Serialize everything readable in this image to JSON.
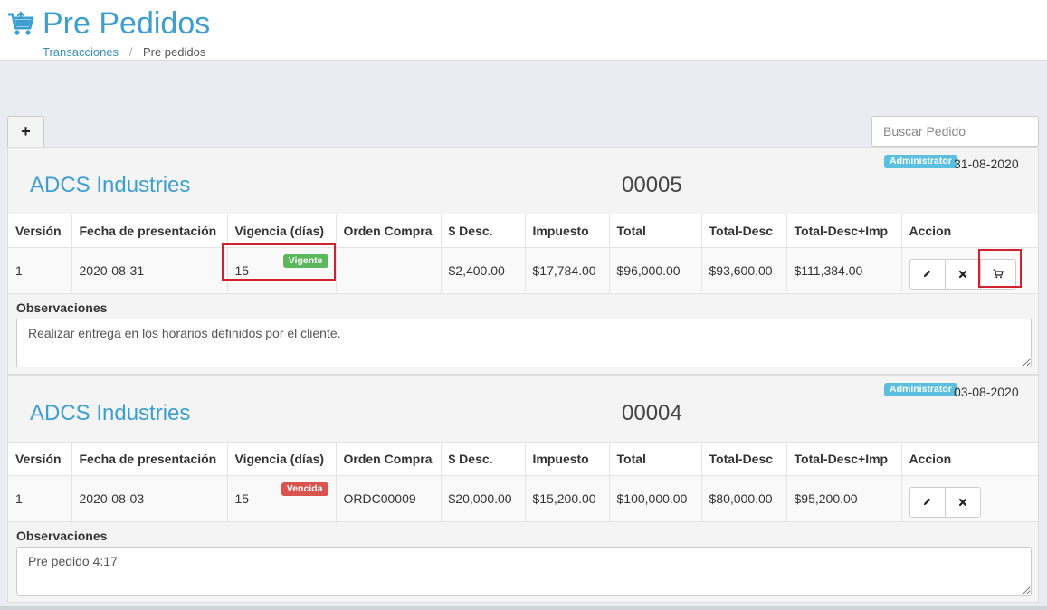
{
  "header": {
    "title": "Pre Pedidos",
    "icon": "shopping-cart-icon",
    "accent_color": "#3d9fd1",
    "breadcrumb": [
      {
        "label": "Transacciones"
      },
      {
        "label": "Pre pedidos"
      }
    ]
  },
  "toolbar": {
    "add_label": "+",
    "search_placeholder": "Buscar Pedido"
  },
  "table_columns": [
    "Versión",
    "Fecha de presentación",
    "Vigencia (días)",
    "Orden Compra",
    "$ Desc.",
    "Impuesto",
    "Total",
    "Total-Desc",
    "Total-Desc+Imp",
    "Accion"
  ],
  "observations_label": "Observaciones",
  "orders": [
    {
      "user_badge": "Administrator",
      "date": "31-08-2020",
      "client": "ADCS Industries",
      "number": "00005",
      "row": {
        "version": "1",
        "fecha": "2020-08-31",
        "vigencia": "15",
        "status": "Vigente",
        "status_color": "#5cb85c",
        "orden_compra": "",
        "desc": "$2,400.00",
        "impuesto": "$17,784.00",
        "total": "$96,000.00",
        "total_desc": "$93,600.00",
        "total_desc_imp": "$111,384.00"
      },
      "actions": [
        "pencil-icon",
        "times-icon",
        "cart-icon"
      ],
      "observations": "Realizar entrega en los horarios definidos por el cliente."
    },
    {
      "user_badge": "Administrator",
      "date": "03-08-2020",
      "client": "ADCS Industries",
      "number": "00004",
      "row": {
        "version": "1",
        "fecha": "2020-08-03",
        "vigencia": "15",
        "status": "Vencida",
        "status_color": "#d9534f",
        "orden_compra": "ORDC00009",
        "desc": "$20,000.00",
        "impuesto": "$15,200.00",
        "total": "$100,000.00",
        "total_desc": "$80,000.00",
        "total_desc_imp": "$95,200.00"
      },
      "actions": [
        "pencil-icon",
        "times-icon"
      ],
      "observations": "Pre pedido 4:17"
    }
  ]
}
